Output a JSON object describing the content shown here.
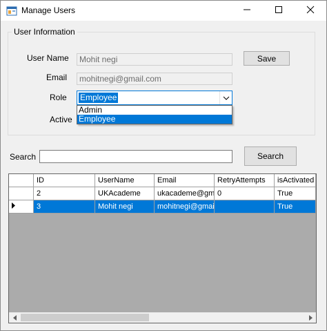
{
  "window": {
    "title": "Manage Users",
    "icon": "app-window-icon"
  },
  "user_info": {
    "group_title": "User Information",
    "username_label": "User Name",
    "username_value": "Mohit negi",
    "email_label": "Email",
    "email_value": "mohitnegi@gmail.com",
    "role_label": "Role",
    "role_selected": "Employee",
    "role_options": [
      "Admin",
      "Employee"
    ],
    "active_label": "Active",
    "save_label": "Save"
  },
  "search": {
    "label": "Search",
    "value": "",
    "button_label": "Search"
  },
  "grid": {
    "columns": [
      "ID",
      "UserName",
      "Email",
      "RetryAttempts",
      "isActivated"
    ],
    "rows": [
      [
        "2",
        "UKAcademe",
        "ukacademe@gm...",
        "0",
        "True"
      ],
      [
        "3",
        "Mohit negi",
        "mohitnegi@gmail....",
        "",
        "True"
      ]
    ],
    "selected_row": 1
  },
  "colors": {
    "accent": "#0078d7",
    "grid_background": "#ababab",
    "window_background": "#f0f0f0"
  }
}
